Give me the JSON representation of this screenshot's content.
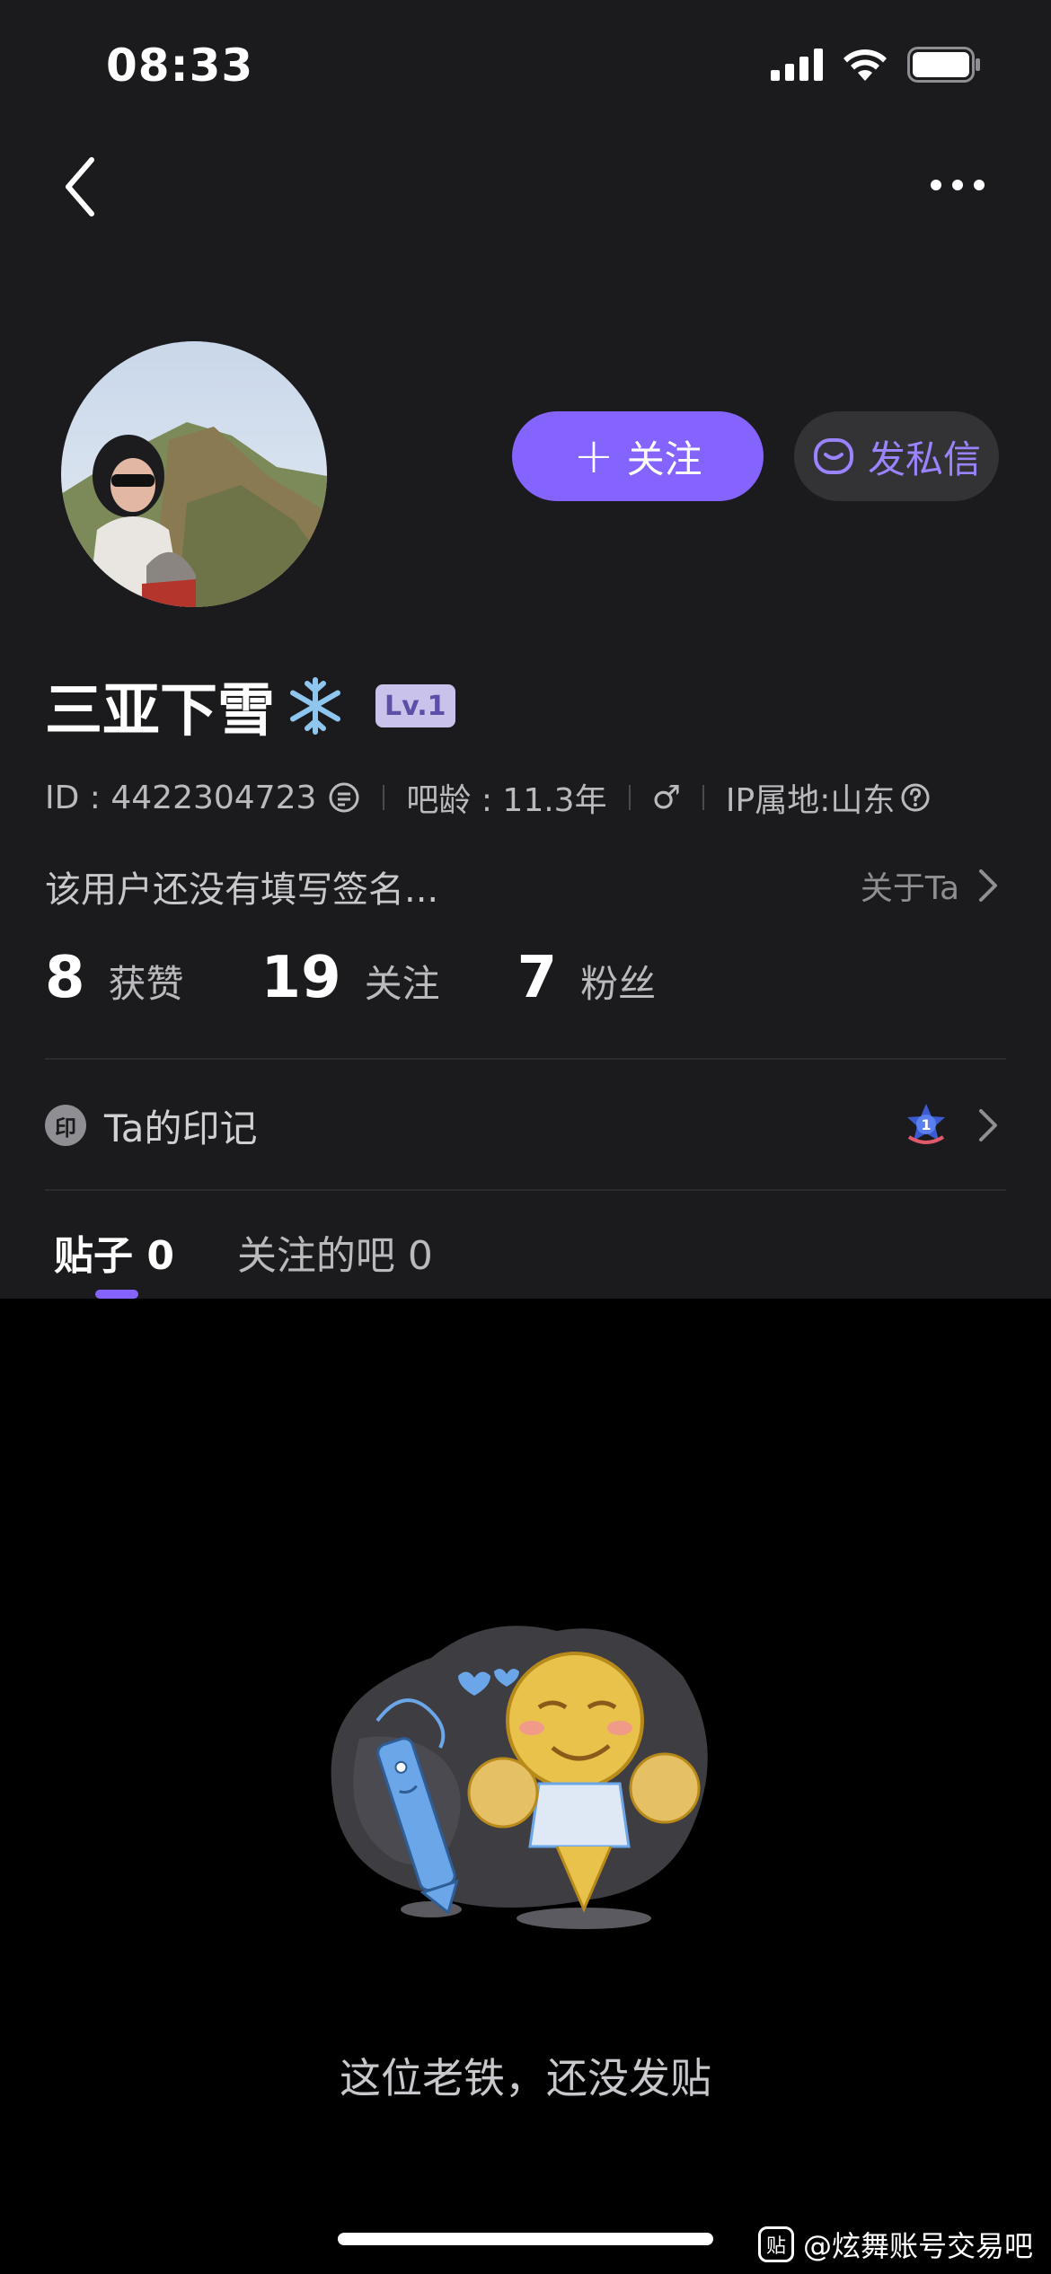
{
  "status_bar": {
    "time": "08:33"
  },
  "profile": {
    "username": "三亚下雪",
    "level": "Lv.1",
    "id_label": "ID : 4422304723",
    "tieba_age": "吧龄 : 11.3年",
    "gender_symbol": "♂",
    "ip_location": "IP属地:山东",
    "bio": "该用户还没有填写签名...",
    "about_link": "关于Ta"
  },
  "actions": {
    "follow_label": "关注",
    "message_label": "发私信"
  },
  "stats": [
    {
      "num": "8",
      "label": "获赞"
    },
    {
      "num": "19",
      "label": "关注"
    },
    {
      "num": "7",
      "label": "粉丝"
    }
  ],
  "marks": {
    "badge_char": "印",
    "label": "Ta的印记",
    "badge_number": "1"
  },
  "tabs": [
    {
      "label": "贴子 0",
      "active": true
    },
    {
      "label": "关注的吧 0",
      "active": false
    }
  ],
  "empty_state": {
    "text": "这位老铁，还没发贴"
  },
  "watermark": {
    "logo": "贴",
    "text": "@炫舞账号交易吧"
  },
  "colors": {
    "accent": "#8563ff",
    "background": "#1b1b1d",
    "content_bg": "#000000"
  }
}
